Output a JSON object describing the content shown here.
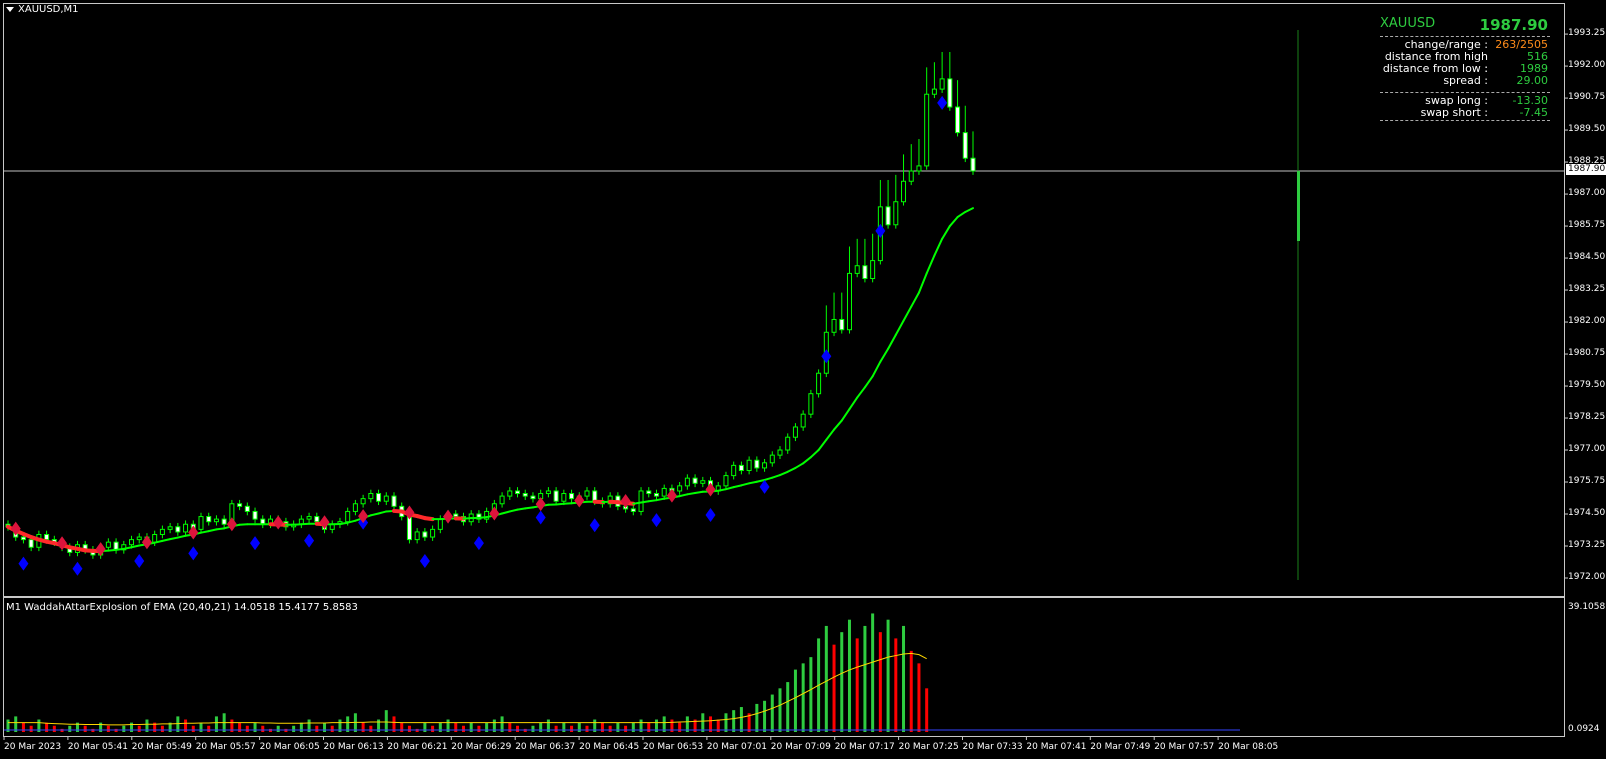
{
  "chart_title": "XAUUSD,M1",
  "indicator_label": "M1  WaddahAttarExplosion of EMA (20,40,21) 14.0518 15.4177 5.8583",
  "price_axis_ticks": [
    "1993.25",
    "1992.00",
    "1990.75",
    "1989.50",
    "1988.25",
    "1987.00",
    "1985.75",
    "1984.50",
    "1983.25",
    "1982.00",
    "1980.75",
    "1979.50",
    "1978.25",
    "1977.00",
    "1975.75",
    "1974.50",
    "1973.25",
    "1972.00"
  ],
  "current_price_tag": "1987.90",
  "indicator_axis": {
    "top": "39.1058",
    "bottom": "0.0924",
    "bottom_overlap": "0.00"
  },
  "time_axis": [
    "20 Mar 2023",
    "20 Mar 05:41",
    "20 Mar 05:49",
    "20 Mar 05:57",
    "20 Mar 06:05",
    "20 Mar 06:13",
    "20 Mar 06:21",
    "20 Mar 06:29",
    "20 Mar 06:37",
    "20 Mar 06:45",
    "20 Mar 06:53",
    "20 Mar 07:01",
    "20 Mar 07:09",
    "20 Mar 07:17",
    "20 Mar 07:25",
    "20 Mar 07:33",
    "20 Mar 07:41",
    "20 Mar 07:49",
    "20 Mar 07:57",
    "20 Mar 08:05"
  ],
  "info_panel": {
    "symbol": "XAUUSD",
    "price": "1987.90",
    "rows1": [
      {
        "k": "change/range :",
        "v": "263/2505",
        "vcolor": "#ff8c1a"
      },
      {
        "k": "distance from high :",
        "v": "516",
        "vcolor": "#2ecc40"
      },
      {
        "k": "distance from low :",
        "v": "1989",
        "vcolor": "#2ecc40"
      },
      {
        "k": "spread :",
        "v": "29.00",
        "vcolor": "#2ecc40"
      }
    ],
    "rows2": [
      {
        "k": "swap long :",
        "v": "-13.30",
        "vcolor": "#2ecc40"
      },
      {
        "k": "swap short :",
        "v": "-7.45",
        "vcolor": "#2ecc40"
      }
    ]
  },
  "colors": {
    "bull": "#00ff00",
    "bear": "#00ff00",
    "ma_up": "#00ff00",
    "ma_down": "#ff2a2a",
    "signal_buy": "#0000ff",
    "signal_sell": "#dc143c",
    "vol_up": "#2ecc40",
    "vol_down": "#ff0000",
    "explosion_line": "#ffd700"
  },
  "chart_data": {
    "type": "candlestick",
    "symbol": "XAUUSD",
    "timeframe": "M1",
    "ylim": [
      1972.0,
      1993.8
    ],
    "closes": [
      1974.0,
      1973.6,
      1973.5,
      1973.2,
      1973.7,
      1973.5,
      1973.4,
      1973.2,
      1973.0,
      1973.3,
      1973.1,
      1972.9,
      1973.2,
      1973.4,
      1973.1,
      1973.3,
      1973.5,
      1973.6,
      1973.4,
      1973.7,
      1973.9,
      1974.0,
      1973.8,
      1974.1,
      1973.9,
      1974.4,
      1974.2,
      1974.3,
      1974.1,
      1974.9,
      1974.8,
      1974.6,
      1974.3,
      1974.1,
      1974.3,
      1974.2,
      1974.0,
      1974.1,
      1974.3,
      1974.4,
      1974.2,
      1973.9,
      1974.1,
      1974.2,
      1974.6,
      1974.9,
      1975.1,
      1975.3,
      1975.0,
      1975.2,
      1974.8,
      1974.4,
      1973.5,
      1973.8,
      1973.6,
      1973.9,
      1974.3,
      1974.5,
      1974.4,
      1974.2,
      1974.5,
      1974.3,
      1974.6,
      1974.9,
      1975.2,
      1975.4,
      1975.3,
      1975.2,
      1975.1,
      1975.3,
      1975.4,
      1975.0,
      1975.3,
      1975.1,
      1975.2,
      1975.4,
      1975.0,
      1974.9,
      1975.2,
      1974.8,
      1974.7,
      1974.6,
      1975.4,
      1975.3,
      1975.2,
      1975.5,
      1975.4,
      1975.6,
      1975.9,
      1975.7,
      1975.8,
      1975.4,
      1975.6,
      1976.0,
      1976.4,
      1976.2,
      1976.6,
      1976.3,
      1976.5,
      1976.8,
      1977.0,
      1977.5,
      1977.9,
      1978.4,
      1979.2,
      1980.0,
      1981.6,
      1982.1,
      1981.7,
      1983.9,
      1984.2,
      1983.7,
      1984.4,
      1986.5,
      1985.8,
      1986.7,
      1987.5,
      1987.9,
      1988.1,
      1990.9,
      1991.1,
      1991.5,
      1990.4,
      1989.4,
      1988.4,
      1987.9
    ],
    "ma_values": [
      1974.0,
      1973.85,
      1973.72,
      1973.6,
      1973.5,
      1973.42,
      1973.36,
      1973.28,
      1973.2,
      1973.14,
      1973.08,
      1973.06,
      1973.05,
      1973.07,
      1973.1,
      1973.14,
      1973.2,
      1973.27,
      1973.32,
      1973.38,
      1973.45,
      1973.52,
      1973.58,
      1973.65,
      1973.7,
      1973.77,
      1973.83,
      1973.9,
      1973.94,
      1974.02,
      1974.08,
      1974.1,
      1974.1,
      1974.1,
      1974.1,
      1974.09,
      1974.08,
      1974.08,
      1974.1,
      1974.12,
      1974.12,
      1974.1,
      1974.1,
      1974.11,
      1974.16,
      1974.24,
      1974.34,
      1974.45,
      1974.52,
      1974.6,
      1974.62,
      1974.6,
      1974.48,
      1974.42,
      1974.34,
      1974.3,
      1974.3,
      1974.32,
      1974.33,
      1974.32,
      1974.34,
      1974.35,
      1974.38,
      1974.44,
      1974.52,
      1974.6,
      1974.67,
      1974.72,
      1974.76,
      1974.81,
      1974.86,
      1974.87,
      1974.9,
      1974.92,
      1974.95,
      1974.98,
      1974.98,
      1974.97,
      1974.98,
      1974.96,
      1974.93,
      1974.9,
      1974.95,
      1975.0,
      1975.04,
      1975.1,
      1975.14,
      1975.2,
      1975.27,
      1975.32,
      1975.37,
      1975.38,
      1975.41,
      1975.47,
      1975.55,
      1975.62,
      1975.7,
      1975.76,
      1975.83,
      1975.92,
      1976.02,
      1976.15,
      1976.3,
      1976.48,
      1976.72,
      1977.0,
      1977.4,
      1977.8,
      1978.15,
      1978.6,
      1979.05,
      1979.45,
      1979.88,
      1980.45,
      1980.95,
      1981.5,
      1982.05,
      1982.6,
      1983.15,
      1983.9,
      1984.6,
      1985.25,
      1985.75,
      1986.1,
      1986.3,
      1986.45
    ],
    "buy_signals": [
      9,
      10,
      16,
      18,
      19,
      27,
      30,
      39,
      42,
      45,
      53,
      55,
      60,
      62,
      63,
      66,
      67
    ],
    "sell_signals": [
      1,
      6,
      7,
      10,
      25,
      27,
      33,
      34,
      35,
      45,
      46,
      48,
      50,
      51,
      57,
      59,
      60
    ],
    "indicator_values": [
      4,
      5,
      3,
      2,
      4,
      3,
      2,
      1,
      2,
      3,
      2,
      1,
      3,
      2,
      1,
      2,
      3,
      2,
      4,
      3,
      2,
      3,
      5,
      4,
      2,
      3,
      2,
      5,
      6,
      4,
      3,
      2,
      3,
      2,
      1,
      2,
      1,
      2,
      3,
      4,
      2,
      3,
      2,
      4,
      5,
      6,
      3,
      2,
      4,
      7,
      5,
      3,
      2,
      1,
      3,
      2,
      3,
      4,
      3,
      2,
      3,
      2,
      3,
      4,
      5,
      3,
      2,
      1,
      2,
      3,
      4,
      2,
      3,
      2,
      3,
      2,
      4,
      3,
      2,
      3,
      2,
      3,
      4,
      3,
      4,
      5,
      4,
      3,
      5,
      4,
      6,
      5,
      4,
      6,
      7,
      8,
      6,
      9,
      10,
      12,
      14,
      16,
      20,
      22,
      24,
      30,
      34,
      28,
      32,
      36,
      30,
      34,
      38,
      32,
      36,
      30,
      34,
      26,
      22,
      14
    ],
    "explosion_line": [
      3,
      3,
      3,
      3,
      3,
      2.8,
      2.7,
      2.6,
      2.5,
      2.5,
      2.4,
      2.4,
      2.4,
      2.3,
      2.3,
      2.3,
      2.4,
      2.4,
      2.5,
      2.5,
      2.6,
      2.6,
      2.7,
      2.8,
      2.8,
      2.9,
      2.9,
      3,
      3,
      3,
      3,
      3,
      3,
      2.9,
      2.9,
      2.8,
      2.8,
      2.8,
      2.8,
      2.9,
      2.9,
      2.9,
      3,
      3,
      3,
      3.1,
      3.1,
      3.2,
      3.2,
      3.2,
      3.1,
      3,
      3,
      3,
      3,
      3,
      3,
      3,
      3,
      3,
      3,
      3,
      3,
      3,
      3,
      3,
      3,
      3,
      3,
      3,
      3,
      3,
      3,
      3,
      3,
      3,
      3,
      3,
      3,
      3,
      3,
      3,
      3,
      3,
      3,
      3,
      3.1,
      3.2,
      3.3,
      3.4,
      3.5,
      3.6,
      3.8,
      4,
      4.3,
      4.7,
      5.2,
      5.9,
      6.7,
      7.6,
      8.6,
      9.8,
      11,
      12.3,
      13.6,
      15,
      16.3,
      17.6,
      18.8,
      19.9,
      20.8,
      21.6,
      22.4,
      23.2,
      24,
      24.5,
      25,
      25.2,
      24.8,
      23.5
    ]
  }
}
